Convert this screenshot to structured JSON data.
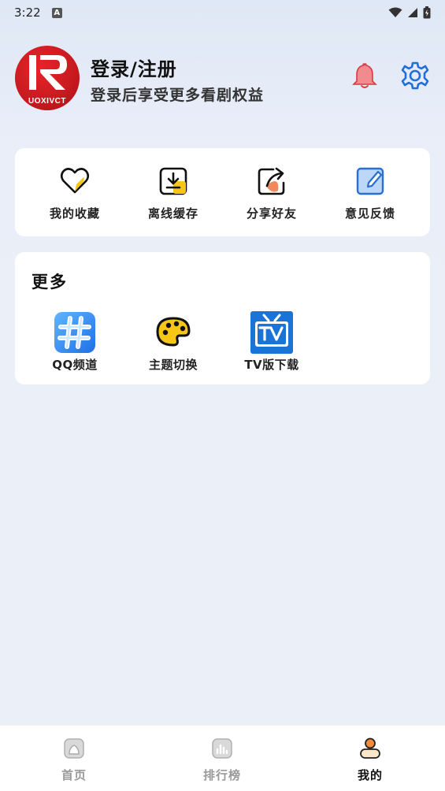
{
  "status_bar": {
    "time": "3:22",
    "notification_glyph": "A"
  },
  "header": {
    "avatar_brand_text": "UOXIVCT",
    "login_title": "登录/注册",
    "login_subtitle": "登录后享受更多看剧权益"
  },
  "quick_actions": [
    {
      "label": "我的收藏",
      "icon": "heart-icon"
    },
    {
      "label": "离线缓存",
      "icon": "download-icon"
    },
    {
      "label": "分享好友",
      "icon": "share-icon"
    },
    {
      "label": "意见反馈",
      "icon": "feedback-icon"
    }
  ],
  "more": {
    "title": "更多",
    "items": [
      {
        "label": "QQ频道",
        "icon": "qq-channel-icon"
      },
      {
        "label": "主题切换",
        "icon": "palette-icon"
      },
      {
        "label": "TV版下载",
        "icon": "tv-icon"
      }
    ]
  },
  "bottom_nav": [
    {
      "label": "首页",
      "icon": "home-icon",
      "active": false
    },
    {
      "label": "排行榜",
      "icon": "ranking-icon",
      "active": false
    },
    {
      "label": "我的",
      "icon": "profile-icon",
      "active": true
    }
  ],
  "colors": {
    "background": "#eaeff8",
    "accent_blue": "#1e6fd9",
    "accent_yellow": "#f5c518",
    "bell_red": "#e8474f",
    "brand_red": "#c61a1f"
  }
}
